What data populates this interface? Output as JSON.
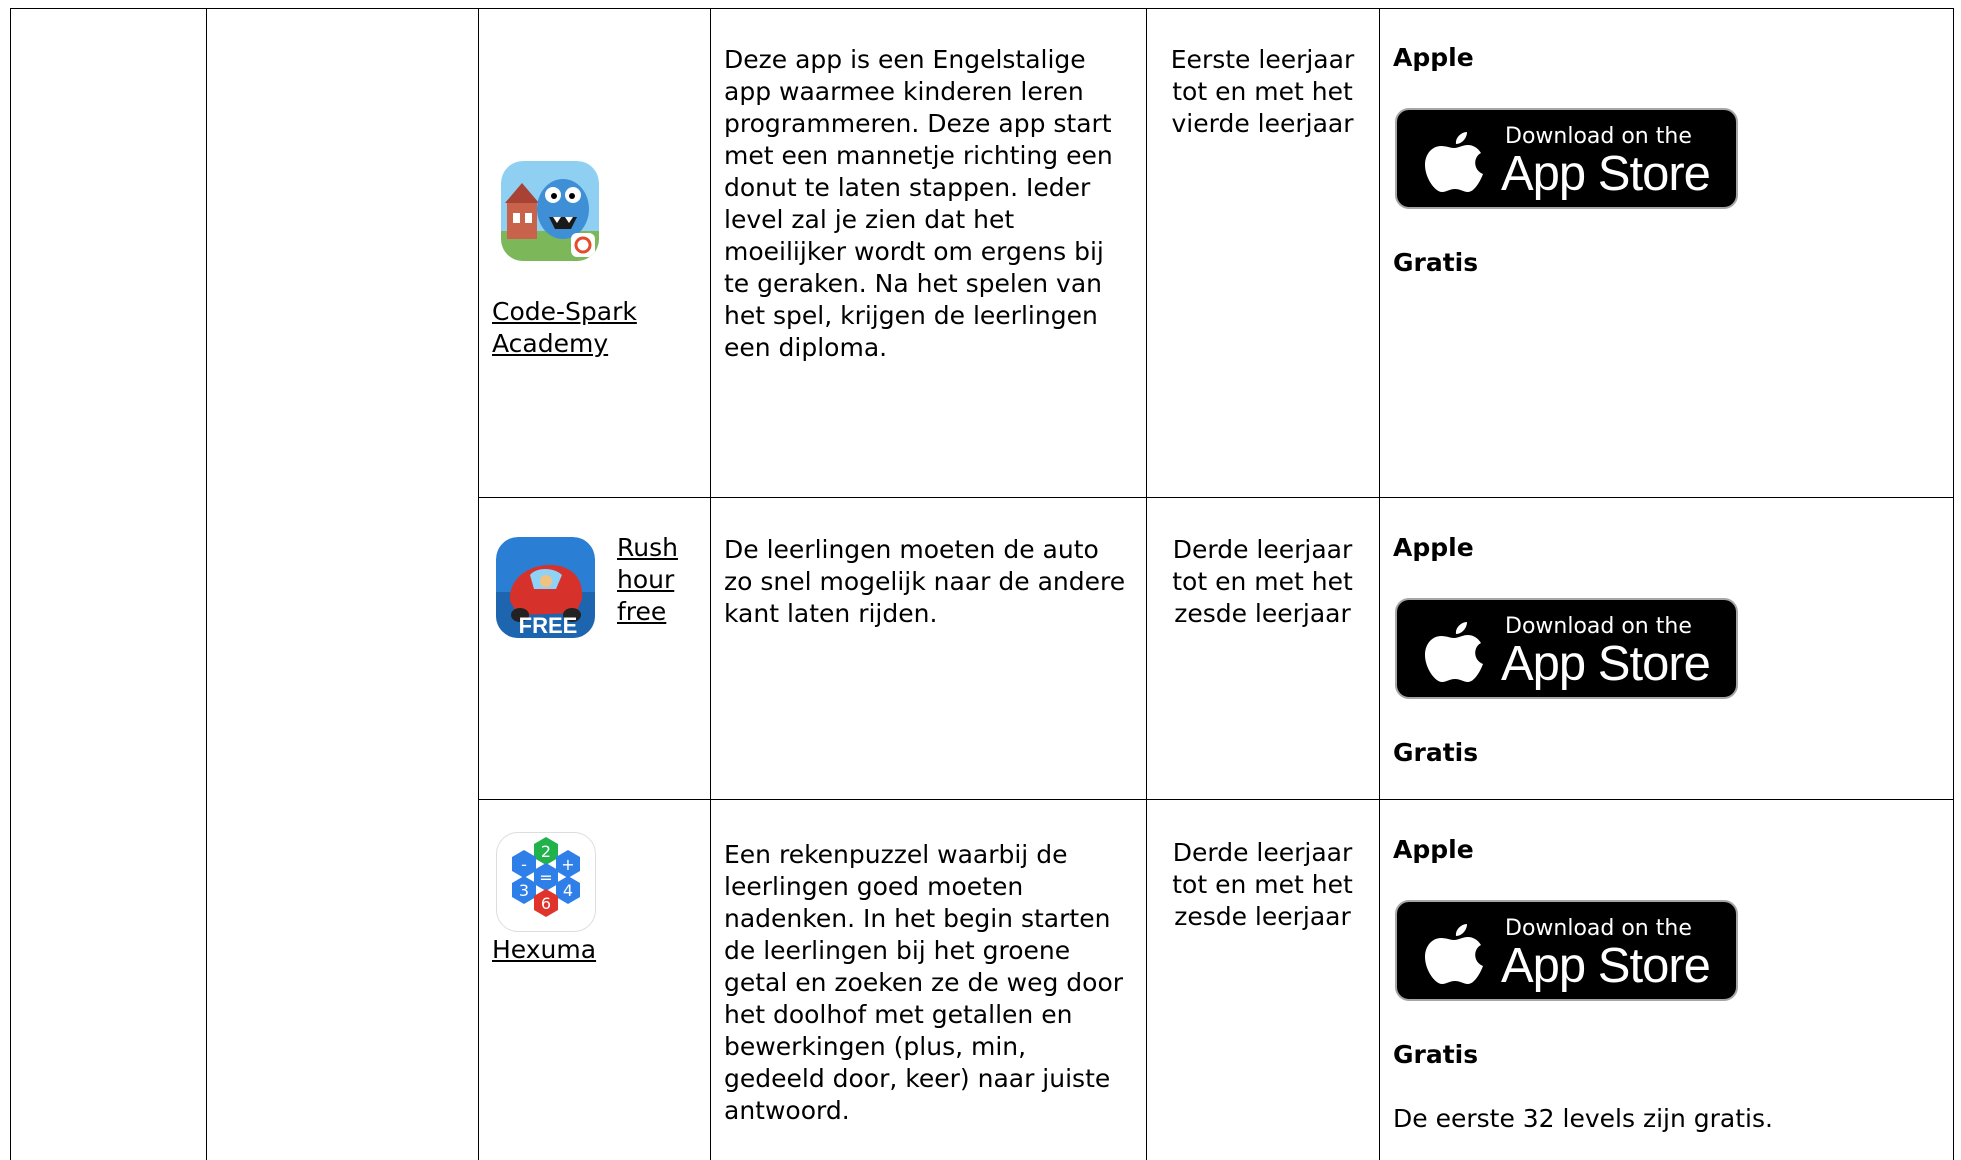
{
  "rows": [
    {
      "app_name": "Code-Spark Academy",
      "description": "Deze app is een Engelstalige app waarmee kinderen leren programmeren. Deze app start met een mannetje richting een donut te laten stappen. Ieder level zal je zien dat het moeilijker wordt om ergens bij te geraken. Na het spelen van het spel, krijgen de leerlingen een diploma.",
      "age": "Eerste leerjaar tot en met het vierde leerjaar",
      "platform": "Apple",
      "badge_small": "Download on the",
      "badge_big": "App Store",
      "price": "Gratis",
      "icon": "code-spark-monster-icon"
    },
    {
      "app_name": "Rush hour free",
      "description": "De leerlingen moeten de auto zo snel mogelijk naar de andere kant laten rijden.",
      "age": "Derde leerjaar tot en met het zesde leerjaar",
      "platform": "Apple",
      "badge_small": "Download on the",
      "badge_big": "App Store",
      "price": "Gratis",
      "icon": "rush-hour-car-icon",
      "icon_label": "FREE"
    },
    {
      "app_name": "Hexuma",
      "description": "Een rekenpuzzel waarbij de leerlingen goed moeten nadenken. In het begin starten de leerlingen bij het groene getal en zoeken ze de weg door het doolhof met getallen en bewerkingen (plus, min, gedeeld door, keer) naar juiste antwoord.",
      "age": "Derde leerjaar tot en met het zesde leerjaar",
      "platform": "Apple",
      "badge_small": "Download on the",
      "badge_big": "App Store",
      "price": "Gratis",
      "note": "De eerste 32 levels zijn gratis.",
      "icon": "hexuma-hexagon-icon",
      "hex_labels": [
        "2",
        "-",
        "+",
        "=",
        "3",
        "4",
        "6"
      ]
    }
  ],
  "colors": {
    "border": "#000000",
    "badge_bg": "#000000",
    "badge_border": "#a6a6a6",
    "hex_blue": "#2f7fe8",
    "hex_green": "#22b24c",
    "hex_red": "#e0332c"
  }
}
